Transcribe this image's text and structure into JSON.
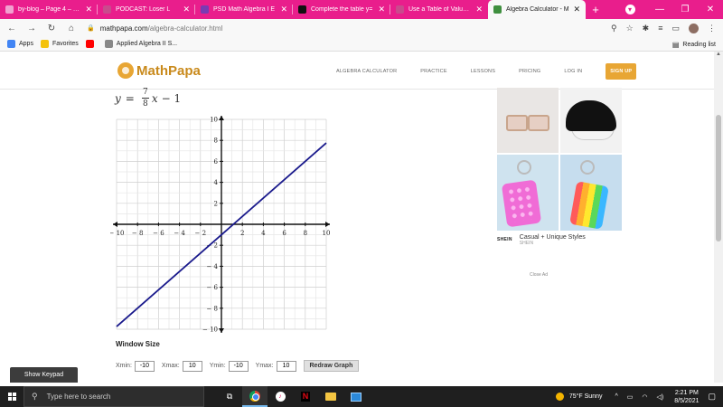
{
  "browser": {
    "tabs": [
      {
        "title": "by-blog – Page 4 – MC",
        "color": "#f1a1d0",
        "active": false
      },
      {
        "title": "PODCAST: Loser L",
        "color": "#c94b8d",
        "active": false
      },
      {
        "title": "PSD Math Algebra I E",
        "color": "#7a3bb3",
        "active": false
      },
      {
        "title": "Complete the table y=",
        "color": "#111111",
        "active": false
      },
      {
        "title": "Use a Table of Values t",
        "color": "#c94b8d",
        "active": false
      },
      {
        "title": "Algebra Calculator - M",
        "color": "#3f8f3f",
        "active": true
      }
    ],
    "new_tab": "+",
    "address": {
      "host": "mathpapa.com",
      "path": "/algebra-calculator.html"
    },
    "bookmarks": [
      {
        "label": "Apps",
        "color": "#4285f4"
      },
      {
        "label": "Favorites",
        "color": "#f4c20d"
      },
      {
        "label": "",
        "color": "#ff0000"
      },
      {
        "label": "Applied Algebra II S...",
        "color": "#888888"
      }
    ],
    "reading_list": "Reading list"
  },
  "site": {
    "logo": "MathPapa",
    "nav": [
      "ALGEBRA CALCULATOR",
      "PRACTICE",
      "LESSONS",
      "PRICING",
      "LOG IN"
    ],
    "signup": "SIGN UP"
  },
  "equation": {
    "lhs": "y",
    "equals": "=",
    "num": "7",
    "den": "8",
    "var": "x",
    "rest": "− 1"
  },
  "chart_data": {
    "type": "line",
    "title": "",
    "xlabel": "",
    "ylabel": "",
    "xlim": [
      -10,
      10
    ],
    "ylim": [
      -10,
      10
    ],
    "xticks": [
      -10,
      -8,
      -6,
      -4,
      -2,
      2,
      4,
      6,
      8,
      10
    ],
    "yticks": [
      -10,
      -8,
      -6,
      -4,
      -2,
      2,
      4,
      6,
      8,
      10
    ],
    "grid": true,
    "series": [
      {
        "slope": 0.875,
        "intercept": -1,
        "x": [
          -10,
          10
        ],
        "y": [
          -9.75,
          7.75
        ],
        "color": "#1a1a8c"
      }
    ]
  },
  "window": {
    "title": "Window Size",
    "fields": [
      {
        "label": "Xmin:",
        "value": "-10"
      },
      {
        "label": "Xmax:",
        "value": "10"
      },
      {
        "label": "Ymin:",
        "value": "-10"
      },
      {
        "label": "Ymax:",
        "value": "10"
      }
    ],
    "redraw": "Redraw Graph"
  },
  "ad": {
    "brand": "SHEIN",
    "headline": "Casual + Unique Styles",
    "sub": "SHEIN",
    "close": "Close Ad"
  },
  "keypad": "Show Keypad",
  "taskbar": {
    "search_placeholder": "Type here to search",
    "weather": "75°F  Sunny",
    "time": "2:21 PM",
    "date": "8/5/2021"
  }
}
